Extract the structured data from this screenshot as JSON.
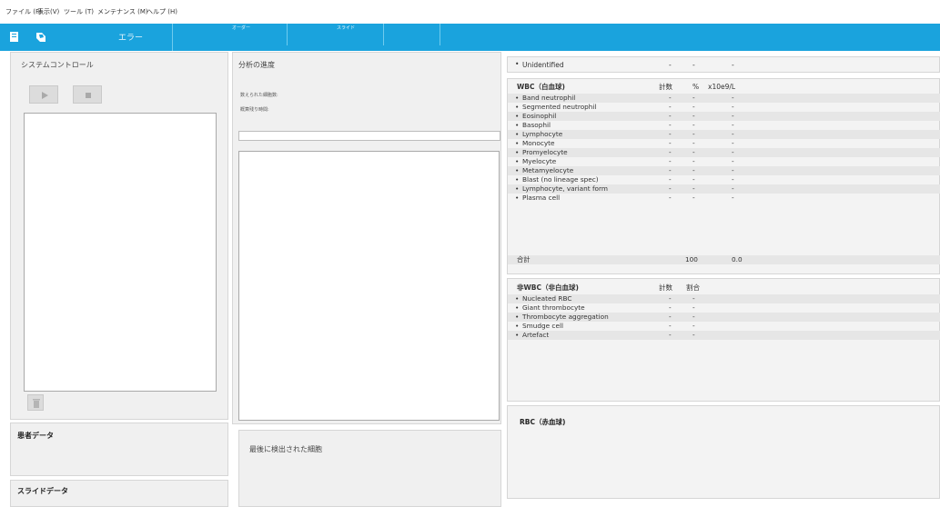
{
  "menu": [
    "ファイル (F)",
    "表示(V)",
    "ツール (T)",
    "メンテナンス (M)",
    "ヘルプ (H)"
  ],
  "toolbar": {
    "error_label": "エラー",
    "order_label": "オーダー",
    "slide_label": "スライド"
  },
  "system_control": {
    "title": "システムコントロール"
  },
  "progress": {
    "title": "分析の進度",
    "counted_cells_label": "数えられた細胞数:",
    "remaining_time_label": "概算残り時間:"
  },
  "patient_data": {
    "title": "患者データ"
  },
  "slide_data": {
    "title": "スライドデータ"
  },
  "last_cell": {
    "title": "最後に検出された細胞"
  },
  "unidentified": {
    "label": "Unidentified",
    "v1": "-",
    "v2": "-",
    "v3": "-"
  },
  "wbc": {
    "title": "WBC（白血球)",
    "col_count": "計数",
    "col_percent": "%",
    "col_unit": "x10e9/L",
    "rows": [
      {
        "name": "Band neutrophil",
        "v1": "-",
        "v2": "-",
        "v3": "-"
      },
      {
        "name": "Segmented neutrophil",
        "v1": "-",
        "v2": "-",
        "v3": "-"
      },
      {
        "name": "Eosinophil",
        "v1": "-",
        "v2": "-",
        "v3": "-"
      },
      {
        "name": "Basophil",
        "v1": "-",
        "v2": "-",
        "v3": "-"
      },
      {
        "name": "Lymphocyte",
        "v1": "-",
        "v2": "-",
        "v3": "-"
      },
      {
        "name": "Monocyte",
        "v1": "-",
        "v2": "-",
        "v3": "-"
      },
      {
        "name": "Promyelocyte",
        "v1": "-",
        "v2": "-",
        "v3": "-"
      },
      {
        "name": "Myelocyte",
        "v1": "-",
        "v2": "-",
        "v3": "-"
      },
      {
        "name": "Metamyelocyte",
        "v1": "-",
        "v2": "-",
        "v3": "-"
      },
      {
        "name": "Blast (no lineage spec)",
        "v1": "-",
        "v2": "-",
        "v3": "-"
      },
      {
        "name": "Lymphocyte, variant form",
        "v1": "-",
        "v2": "-",
        "v3": "-"
      },
      {
        "name": "Plasma cell",
        "v1": "-",
        "v2": "-",
        "v3": "-"
      }
    ],
    "total_label": "合計",
    "total_percent": "100",
    "total_unit": "0.0"
  },
  "non_wbc": {
    "title": "非WBC（非白血球)",
    "col_count": "計数",
    "col_ratio": "割合",
    "rows": [
      {
        "name": "Nucleated RBC",
        "v1": "-",
        "v2": "-"
      },
      {
        "name": "Giant thrombocyte",
        "v1": "-",
        "v2": "-"
      },
      {
        "name": "Thrombocyte aggregation",
        "v1": "-",
        "v2": "-"
      },
      {
        "name": "Smudge cell",
        "v1": "-",
        "v2": "-"
      },
      {
        "name": "Artefact",
        "v1": "-",
        "v2": "-"
      }
    ]
  },
  "rbc": {
    "title": "RBC（赤血球)"
  },
  "colors": {
    "toolbar": "#1aa3dd",
    "panel": "#f0f0f0",
    "row_alt": "#e6e6e6"
  }
}
